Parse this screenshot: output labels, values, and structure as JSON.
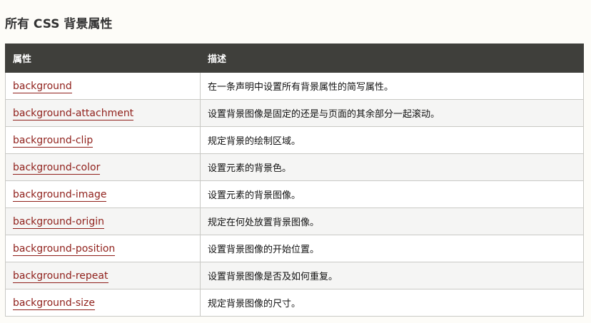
{
  "title": "所有 CSS 背景属性",
  "table": {
    "headers": [
      "属性",
      "描述"
    ],
    "rows": [
      {
        "property": "background",
        "description": "在一条声明中设置所有背景属性的简写属性。"
      },
      {
        "property": "background-attachment",
        "description": "设置背景图像是固定的还是与页面的其余部分一起滚动。"
      },
      {
        "property": "background-clip",
        "description": "规定背景的绘制区域。"
      },
      {
        "property": "background-color",
        "description": "设置元素的背景色。"
      },
      {
        "property": "background-image",
        "description": "设置元素的背景图像。"
      },
      {
        "property": "background-origin",
        "description": "规定在何处放置背景图像。"
      },
      {
        "property": "background-position",
        "description": "设置背景图像的开始位置。"
      },
      {
        "property": "background-repeat",
        "description": "设置背景图像是否及如何重复。"
      },
      {
        "property": "background-size",
        "description": "规定背景图像的尺寸。"
      }
    ]
  }
}
